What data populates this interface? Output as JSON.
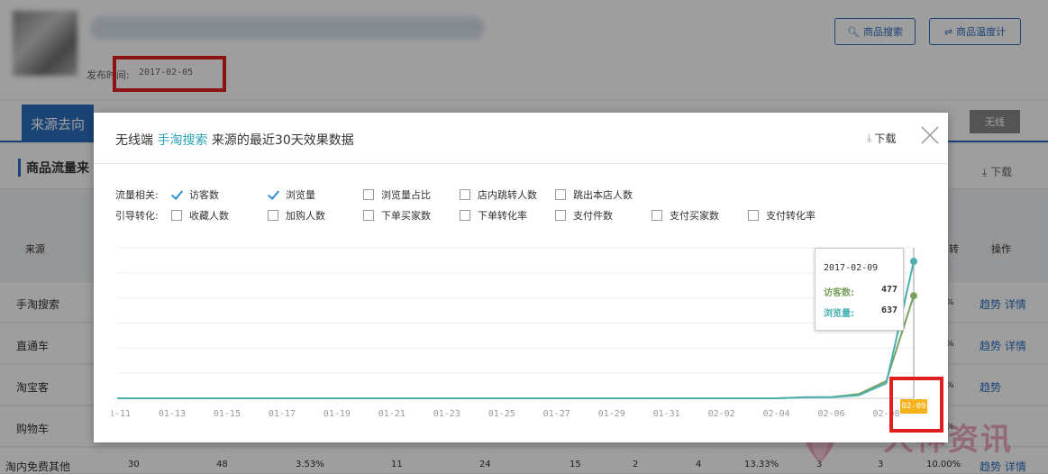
{
  "page": {
    "published_label": "发布时间:",
    "published_value": "2017-02-05",
    "product_search_button": "商品搜索",
    "product_temp_button": "商品温度计",
    "active_tab": "来源去向",
    "right_switch": "无线",
    "section_title": "商品流量来",
    "download": "下载",
    "table_head": {
      "source": "来源",
      "frag": "转",
      "ops": "操作"
    },
    "rows": [
      {
        "label": "手淘搜索",
        "pct": "%",
        "ops": "趋势 详情"
      },
      {
        "label": "直通车",
        "pct": "%",
        "ops": "趋势 详情"
      },
      {
        "label": "淘宝客",
        "pct": "%",
        "ops": "趋势"
      },
      {
        "label": "购物车",
        "pct": "%",
        "ops": ""
      },
      {
        "label": "淘内免费其他",
        "pct": "",
        "ops": "趋势 详情"
      }
    ],
    "last_row_values": [
      "30",
      "48",
      "3.53%",
      "11",
      "24",
      "15",
      "2",
      "4",
      "13.33%",
      "3",
      "3",
      "10.00%"
    ],
    "watermark": "大神资讯"
  },
  "modal": {
    "title_prefix": "无线端",
    "title_source": "手淘搜索",
    "title_suffix": "来源的最近30天效果数据",
    "download": "下载",
    "traffic_label": "流量相关:",
    "conversion_label": "引导转化:",
    "traffic_options": [
      {
        "label": "访客数",
        "checked": true
      },
      {
        "label": "浏览量",
        "checked": true
      },
      {
        "label": "浏览量占比",
        "checked": false
      },
      {
        "label": "店内跳转人数",
        "checked": false
      },
      {
        "label": "跳出本店人数",
        "checked": false
      }
    ],
    "conversion_options": [
      {
        "label": "收藏人数",
        "checked": false
      },
      {
        "label": "加购人数",
        "checked": false
      },
      {
        "label": "下单买家数",
        "checked": false
      },
      {
        "label": "下单转化率",
        "checked": false
      },
      {
        "label": "支付件数",
        "checked": false
      },
      {
        "label": "支付买家数",
        "checked": false
      },
      {
        "label": "支付转化率",
        "checked": false
      }
    ],
    "tooltip": {
      "date": "2017-02-09",
      "visitors_label": "访客数:",
      "visitors_value": "477",
      "pageviews_label": "浏览量:",
      "pageviews_value": "637"
    },
    "highlighted_tick": "02-09"
  },
  "colors": {
    "accent": "#2d6fbf",
    "visitors": "#7aa260",
    "pageviews": "#4ab0b0",
    "highlight": "#f5b21b",
    "annotation": "#e02020"
  },
  "chart_data": {
    "type": "line",
    "x": [
      "01-11",
      "01-12",
      "01-13",
      "01-14",
      "01-15",
      "01-16",
      "01-17",
      "01-18",
      "01-19",
      "01-20",
      "01-21",
      "01-22",
      "01-23",
      "01-24",
      "01-25",
      "01-26",
      "01-27",
      "01-28",
      "01-29",
      "01-30",
      "01-31",
      "02-01",
      "02-02",
      "02-03",
      "02-04",
      "02-05",
      "02-06",
      "02-07",
      "02-08",
      "02-09"
    ],
    "tick_labels": [
      "01-11",
      "01-13",
      "01-15",
      "01-17",
      "01-19",
      "01-21",
      "01-23",
      "01-25",
      "01-27",
      "01-29",
      "01-31",
      "02-02",
      "02-04",
      "02-06",
      "02-08"
    ],
    "series": [
      {
        "name": "访客数",
        "values": [
          0,
          0,
          0,
          0,
          0,
          0,
          0,
          0,
          0,
          0,
          0,
          0,
          0,
          0,
          0,
          0,
          0,
          0,
          0,
          0,
          0,
          0,
          0,
          0,
          0,
          5,
          6,
          20,
          80,
          477
        ]
      },
      {
        "name": "浏览量",
        "values": [
          0,
          0,
          0,
          0,
          0,
          0,
          0,
          0,
          0,
          0,
          0,
          0,
          0,
          0,
          0,
          0,
          0,
          0,
          0,
          0,
          0,
          0,
          0,
          0,
          0,
          4,
          5,
          14,
          70,
          637
        ]
      }
    ],
    "ylim": [
      0,
      700
    ],
    "grid": true
  }
}
